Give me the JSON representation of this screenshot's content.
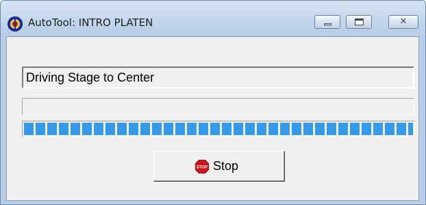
{
  "window": {
    "title": "AutoTool: INTRO PLATEN",
    "icon": "app-logo-icon",
    "caption_buttons": {
      "minimize_icon": "minimize-icon",
      "maximize_icon": "maximize-icon",
      "close_icon": "close-icon",
      "close_glyph": "✕"
    }
  },
  "status": {
    "message": "Driving Stage to Center",
    "secondary_message": ""
  },
  "progress": {
    "value_percent": 100,
    "color": "#3399e8"
  },
  "actions": {
    "stop_label": "Stop",
    "stop_icon": "stop-sign-icon",
    "stop_icon_text": "STOP",
    "stop_icon_color": "#d4111a"
  }
}
